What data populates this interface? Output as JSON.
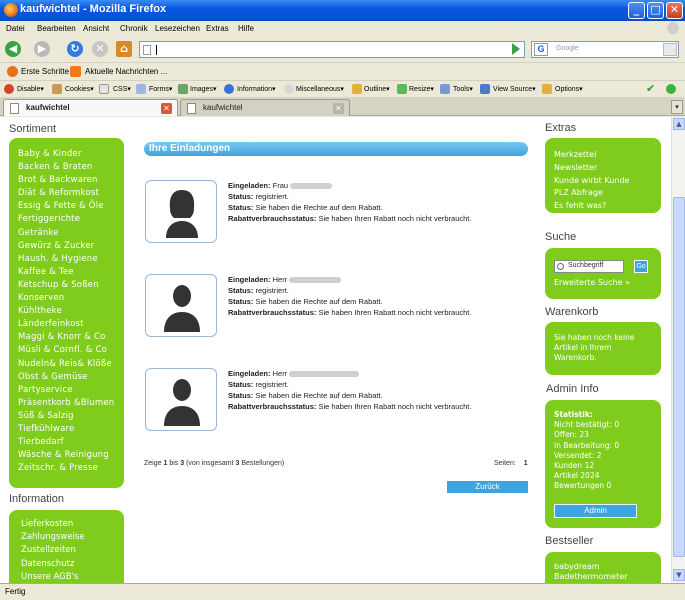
{
  "window": {
    "title": "kaufwichtel - Mozilla Firefox",
    "buttons": {
      "minimize": "_",
      "maximize": "□",
      "close": "✕"
    }
  },
  "menu": [
    "Datei",
    "Bearbeiten",
    "Ansicht",
    "Chronik",
    "Lesezeichen",
    "Extras",
    "Hilfe"
  ],
  "navigation": {
    "url": "",
    "search_placeholder": "Google",
    "search_engine_letter": "G"
  },
  "bookmarks": [
    "Erste Schritte",
    "Aktuelle Nachrichten ..."
  ],
  "devtoolbar": [
    "Disable▾",
    "Cookies▾",
    "CSS▾",
    "Forms▾",
    "Images▾",
    "Information▾",
    "Miscellaneous▾",
    "Outline▾",
    "Resize▾",
    "Tools▾",
    "View Source▾",
    "Options▾"
  ],
  "tabs": [
    {
      "label": "kaufwichtel",
      "active": true
    },
    {
      "label": "kaufwichtel",
      "active": false
    }
  ],
  "left": {
    "sortiment_heading": "Sortiment",
    "sortiment": [
      "Baby & Kinder",
      "Backen & Braten",
      "Brot & Backwaren",
      "Diät & Reformkost",
      "Essig & Fette & Öle",
      "Fertiggerichte",
      "Getränke",
      "Gewürz & Zucker",
      "Haush. & Hygiene",
      "Kaffee & Tee",
      "Ketschup & Soßen",
      "Konserven",
      "Kühltheke",
      "Länderfeinkost",
      "Maggi & Knorr & Co",
      "Müsli & Cornfl. & Co",
      "Nudeln& Reis& Klöße",
      "Obst & Gemüse",
      "Partyservice",
      "Präsentkorb &Blumen",
      "Süß & Salzig",
      "Tiefkühlware",
      "Tierbedarf",
      "Wäsche & Reinigung",
      "Zeitschr. & Presse"
    ],
    "information_heading": "Information",
    "information": [
      "Lieferkosten",
      "Zahlungsweise",
      "Zustellzeiten",
      "Datenschutz",
      "Unsere AGB's"
    ]
  },
  "main": {
    "heading": "Ihre Einladungen",
    "invitations": [
      {
        "invited_label": "Eingeladen:",
        "salutation": "Frau",
        "status_label": "Status:",
        "status_value": "registriert.",
        "status2_label": "Status:",
        "status2_value": "Sie haben die Rechte auf dem Rabatt.",
        "discount_label": "Rabattverbrauchsstatus:",
        "discount_value": "Sie haben Ihren Rabatt noch nicht verbraucht."
      },
      {
        "invited_label": "Eingeladen:",
        "salutation": "Herr",
        "status_label": "Status:",
        "status_value": "registriert.",
        "status2_label": "Status:",
        "status2_value": "Sie haben die Rechte auf dem Rabatt.",
        "discount_label": "Rabattverbrauchsstatus:",
        "discount_value": "Sie haben Ihren Rabatt noch nicht verbraucht."
      },
      {
        "invited_label": "Eingeladen:",
        "salutation": "Herr",
        "status_label": "Status:",
        "status_value": "registriert.",
        "status2_label": "Status:",
        "status2_value": "Sie haben die Rechte auf dem Rabatt.",
        "discount_label": "Rabattverbrauchsstatus:",
        "discount_value": "Sie haben Ihren Rabatt noch nicht verbraucht."
      }
    ],
    "pager": {
      "prefix": "Zeige",
      "from": "1",
      "mid": "bis",
      "to": "3",
      "suffix_a": "(von insgesamt",
      "total": "3",
      "suffix_b": "Bestellungen)",
      "pages_label": "Seiten:",
      "page": "1"
    },
    "back_button": "Zurück"
  },
  "right": {
    "extras_heading": "Extras",
    "extras": [
      "Merkzettel",
      "Newsletter",
      "Kunde wirbt Kunde",
      "PLZ Abfrage",
      "Es fehlt was?"
    ],
    "search_heading": "Suche",
    "search_value": "Suchbegriff",
    "search_go": "Go",
    "search_advanced": "Erweiterte Suche »",
    "cart_heading": "Warenkorb",
    "cart_text": [
      "Sie haben noch keine",
      "Artikel in Ihrem",
      "Warenkorb."
    ],
    "admin_heading": "Admin Info",
    "stats": [
      "Statistik:",
      "Nicht bestätigt: 0",
      "Offen: 23",
      "In Bearbeitung: 0",
      "Versendet: 2",
      "Kunden 12",
      "Artikel 2024",
      "Bewertungen 0"
    ],
    "admin_button": "Admin",
    "bestseller_heading": "Bestseller",
    "bestseller": [
      "babydream",
      "Badethermometer"
    ]
  },
  "status_bar": "Fertig",
  "colors": {
    "green_box": "#80cc1c",
    "blue_accent": "#3fa3dd",
    "titlebar": "#0553d6"
  }
}
